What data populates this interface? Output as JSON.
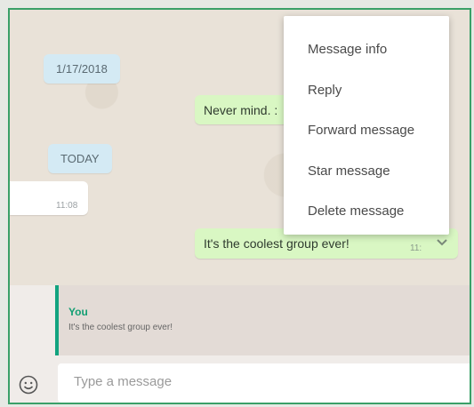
{
  "chat": {
    "date_old": "1/17/2018",
    "date_today": "TODAY",
    "msg_partial": "Never mind. :",
    "incoming_time": "11:08",
    "selected_msg": "It's the coolest group ever!",
    "selected_msg_time": "11:"
  },
  "context_menu": {
    "items": [
      "Message info",
      "Reply",
      "Forward message",
      "Star message",
      "Delete message"
    ]
  },
  "reply_preview": {
    "author": "You",
    "text": "It's the coolest group ever!"
  },
  "compose": {
    "placeholder": "Type a message"
  },
  "icons": {
    "emoji": "emoji-icon",
    "chevron": "chevron-down-icon"
  },
  "colors": {
    "outgoing_bubble": "#d9f7c3",
    "date_pill": "#d4eaf4",
    "accent": "#12a37f",
    "border": "#3aa068"
  }
}
